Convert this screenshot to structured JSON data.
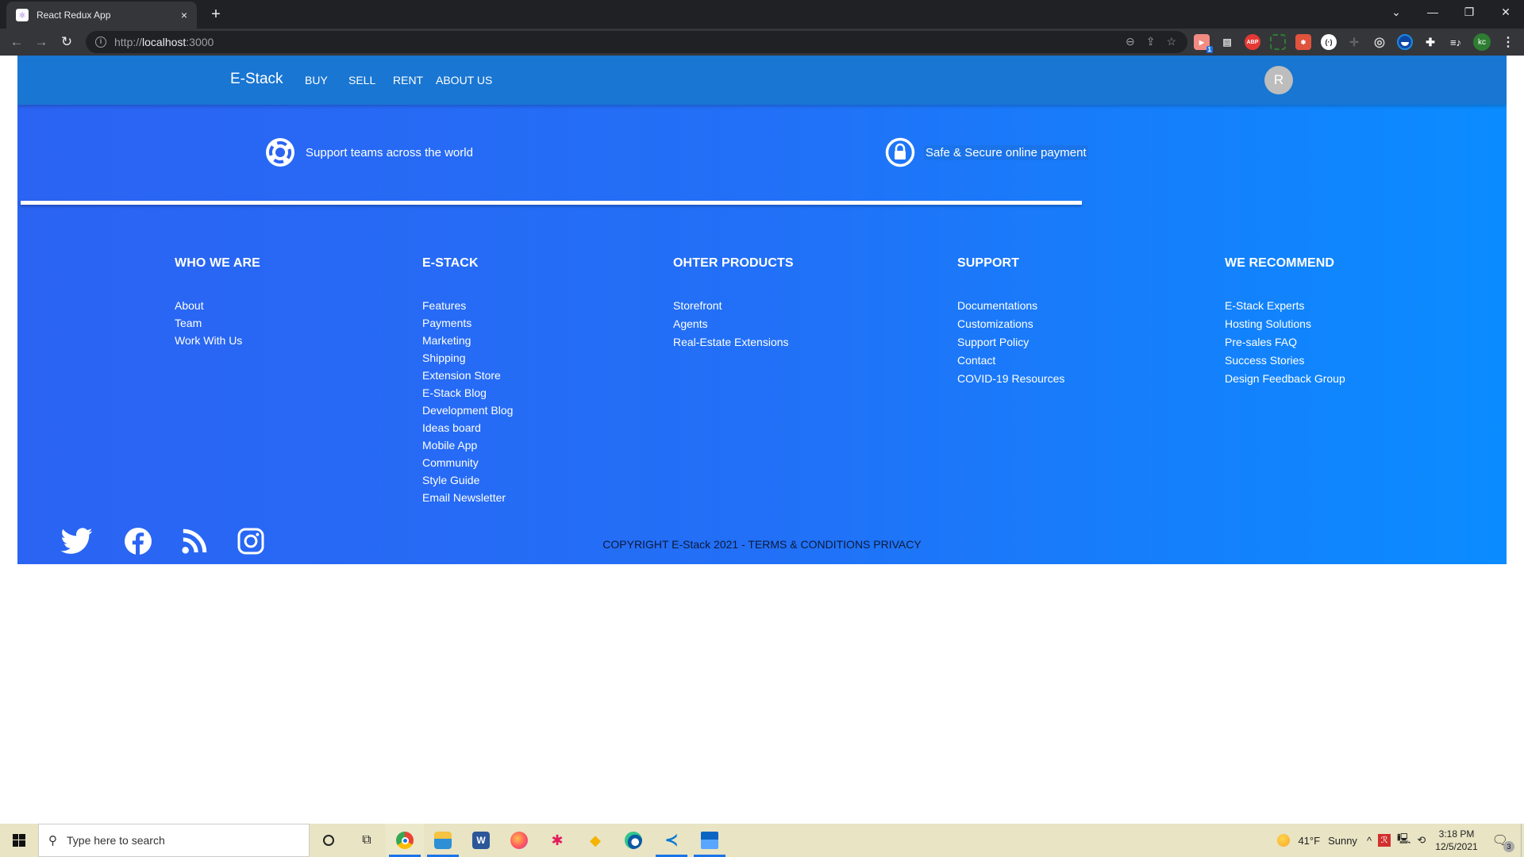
{
  "browser": {
    "tab_title": "React Redux App",
    "tab_close": "×",
    "new_tab": "+",
    "url_scheme": "http://",
    "url_host": "localhost",
    "url_port": ":3000",
    "window_controls": {
      "dropdown": "⌄",
      "minimize": "—",
      "restore": "❐",
      "close": "✕"
    },
    "extensions": [
      "zoom-icon",
      "share-icon",
      "bookmark-star-icon",
      "extension-badge-1",
      "shredder-icon",
      "abp-icon",
      "screen-capture-icon",
      "bug-icon",
      "dots-circle-icon",
      "crosshair-icon",
      "target-icon",
      "water-icon",
      "puzzle-icon",
      "media-queue-icon"
    ],
    "ext_badge_count": "1",
    "abp_label": "ABP",
    "profile_initials": "kc",
    "menu": "⋮"
  },
  "header": {
    "brand": "E-Stack",
    "nav": [
      "BUY",
      "SELL",
      "RENT",
      "ABOUT US"
    ],
    "avatar_initial": "R"
  },
  "features": [
    {
      "icon": "lifebuoy-icon",
      "text": "Support teams across the world"
    },
    {
      "icon": "lock-icon",
      "text": "Safe & Secure online payment"
    }
  ],
  "footer": {
    "columns": [
      {
        "title": "WHO WE ARE",
        "links": [
          "About",
          "Team",
          "Work With Us"
        ]
      },
      {
        "title": "E-STACK",
        "links": [
          "Features",
          "Payments",
          "Marketing",
          "Shipping",
          "Extension Store",
          "E-Stack Blog",
          "Development Blog",
          "Ideas board",
          "Mobile App",
          "Community",
          "Style Guide",
          "Email Newsletter"
        ]
      },
      {
        "title": "OHTER PRODUCTS",
        "links": [
          "Storefront",
          "Agents",
          "Real-Estate Extensions"
        ]
      },
      {
        "title": "SUPPORT",
        "links": [
          "Documentations",
          "Customizations",
          "Support Policy",
          "Contact",
          "COVID-19 Resources"
        ]
      },
      {
        "title": "WE RECOMMEND",
        "links": [
          "E-Stack Experts",
          "Hosting Solutions",
          "Pre-sales FAQ",
          "Success Stories",
          "Design Feedback Group"
        ]
      }
    ],
    "social": [
      "twitter-icon",
      "facebook-icon",
      "rss-icon",
      "instagram-icon"
    ],
    "copyright": "COPYRIGHT E-Stack 2021 - TERMS & CONDITIONS PRIVACY"
  },
  "taskbar": {
    "search_placeholder": "Type here to search",
    "apps": [
      "cortana",
      "task-view",
      "chrome",
      "file-explorer",
      "word",
      "firefox",
      "slack",
      "app-kite",
      "edge",
      "vscode",
      "mail"
    ],
    "weather_temp": "41°F",
    "weather_desc": "Sunny",
    "time": "3:18 PM",
    "date": "12/5/2021",
    "notification_count": "3"
  },
  "colors": {
    "header_bg": "#1976d2",
    "page_gradient_start": "#2b63f2",
    "page_gradient_end": "#0a8cff",
    "avatar_bg": "#bdbdbd"
  }
}
